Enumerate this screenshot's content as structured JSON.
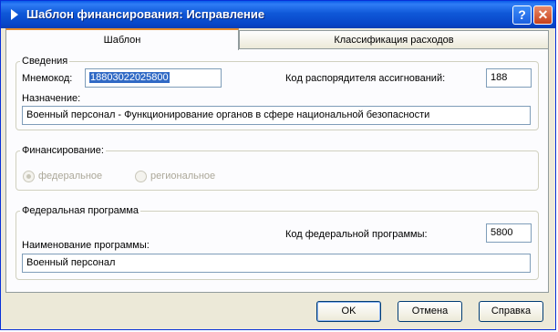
{
  "window": {
    "title": "Шаблон финансирования: Исправление"
  },
  "titlebar": {
    "help_label": "?",
    "close_label": "✕"
  },
  "tabs": [
    {
      "label": "Шаблон",
      "active": true
    },
    {
      "label": "Классификация расходов",
      "active": false
    }
  ],
  "svedeniya": {
    "legend": "Сведения",
    "mnemokod_label": "Мнемокод:",
    "mnemokod_value": "18803022025800",
    "kod_raspor_label": "Кoд распорядителя ассигнований:",
    "kod_raspor_value": "188",
    "naznachenie_label": "Назначение:",
    "naznachenie_value": "Военный персонал - Функционирование органов в сфере национальной безопасности"
  },
  "financing": {
    "legend": "Финансирование:",
    "options": [
      {
        "label": "федеральное",
        "selected": true
      },
      {
        "label": "региональное",
        "selected": false
      }
    ]
  },
  "program": {
    "legend": "Федеральная программа",
    "kod_label": "Код федеральной программы:",
    "kod_value": "5800",
    "name_label": "Наименование программы:",
    "name_value": "Военный персонал"
  },
  "buttons": {
    "ok": "OK",
    "cancel": "Отмена",
    "help": "Справка"
  },
  "colors": {
    "titlebar": "#0a5be8",
    "selection": "#316ac5",
    "tab_highlight": "#e68b2c"
  }
}
